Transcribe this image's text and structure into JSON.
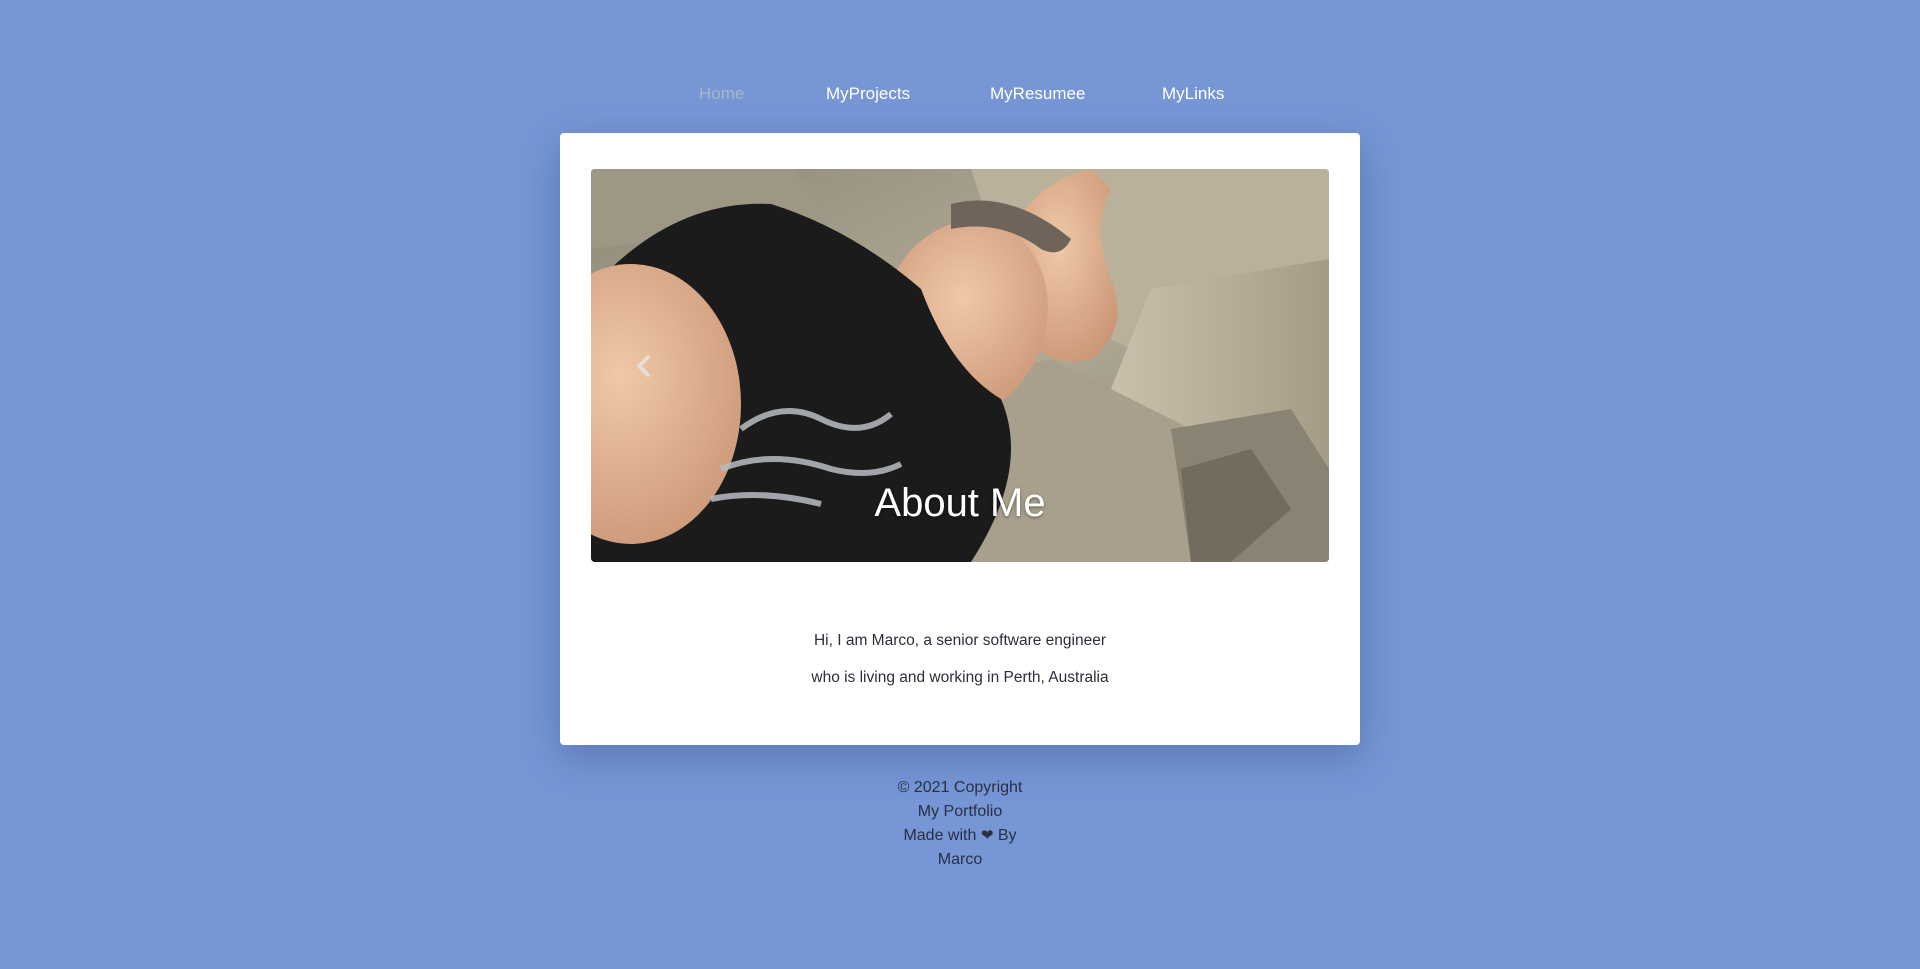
{
  "nav": {
    "items": [
      {
        "label": "Home",
        "active": true
      },
      {
        "label": "MyProjects",
        "active": false
      },
      {
        "label": "MyResumee",
        "active": false
      },
      {
        "label": "MyLinks",
        "active": false
      }
    ]
  },
  "hero": {
    "title": "About Me",
    "prev_icon": "chevron-left-icon"
  },
  "intro": {
    "line1": "Hi, I am Marco, a senior software engineer",
    "line2": "who is living and working in Perth, Australia"
  },
  "footer": {
    "copyright": "© 2021 Copyright",
    "site": "My Portfolio",
    "made_with_prefix": "Made with",
    "heart_icon": "heart-icon",
    "made_with_suffix": "By",
    "author": "Marco"
  },
  "colors": {
    "background": "#7696d6",
    "card": "#ffffff",
    "nav_active": "#aab6c8",
    "nav_text": "#ffffff",
    "text": "#2e2e3a"
  }
}
